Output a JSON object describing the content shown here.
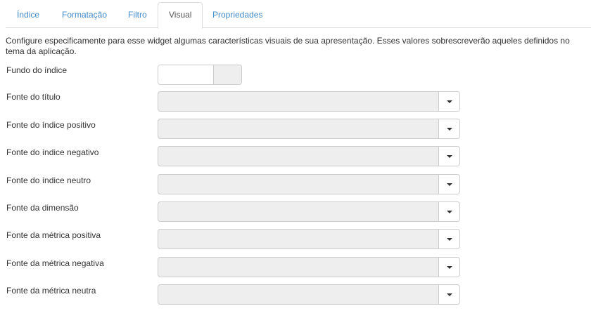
{
  "tabs": [
    {
      "label": "Índice"
    },
    {
      "label": "Formatação"
    },
    {
      "label": "Filtro"
    },
    {
      "label": "Visual",
      "active": true
    },
    {
      "label": "Propriedades"
    }
  ],
  "description": "Configure especificamente para esse widget algumas características visuais de sua apresentação. Esses valores sobrescreverão aqueles definidos no tema da aplicação.",
  "fields": {
    "fundo": {
      "label": "Fundo do índice",
      "value": ""
    },
    "titulo": {
      "label": "Fonte do título",
      "value": ""
    },
    "indice_positivo": {
      "label": "Fonte do índice positivo",
      "value": ""
    },
    "indice_negativo": {
      "label": "Fonte do índice negativo",
      "value": ""
    },
    "indice_neutro": {
      "label": "Fonte do índice neutro",
      "value": ""
    },
    "dimensao": {
      "label": "Fonte da dimensão",
      "value": ""
    },
    "metrica_positiva": {
      "label": "Fonte da métrica positiva",
      "value": ""
    },
    "metrica_negativa": {
      "label": "Fonte da métrica negativa",
      "value": ""
    },
    "metrica_neutra": {
      "label": "Fonte da métrica neutra",
      "value": ""
    }
  },
  "icons": {
    "dropdown": "caret-down-icon"
  },
  "colors": {
    "link": "#428bca",
    "border": "#cccccc",
    "disabled_bg": "#eeeeee"
  }
}
